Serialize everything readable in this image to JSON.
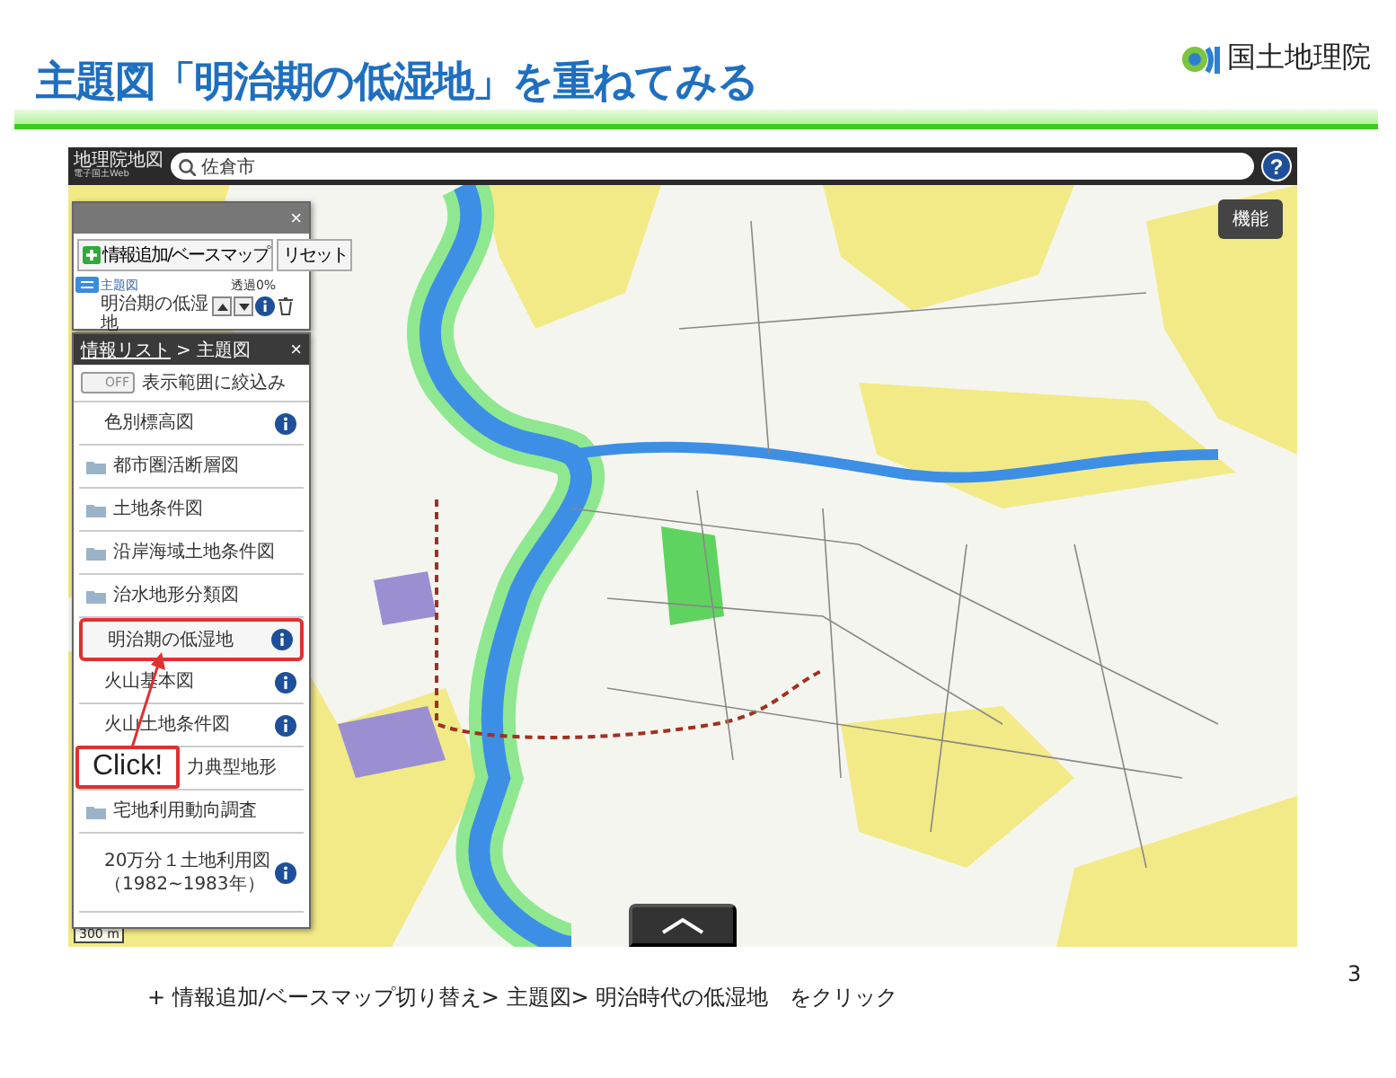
{
  "slide": {
    "title": "主題図「明治期の低湿地」を重ねてみる",
    "logo": "国土地理院",
    "page_number": "3",
    "caption": "+ 情報追加/ベースマップ切り替え> 主題図> 明治時代の低湿地　をクリック"
  },
  "app": {
    "brand": "地理院地図",
    "brand_sub": "電子国土Web",
    "search": {
      "value": "佐倉市"
    },
    "help": "?",
    "function_button": "機能",
    "scale": "300 m",
    "layer_panel": {
      "close": "×",
      "add_button": "情報追加/ベースマップ",
      "reset_button": "リセット",
      "layer": {
        "category": "主題図",
        "name": "明治期の低湿地",
        "opacity": "透過0%"
      }
    },
    "info_list": {
      "breadcrumb_link": "情報リスト",
      "breadcrumb_rest": "> 主題図",
      "close": "×",
      "filter": {
        "on": false,
        "state_label": "OFF",
        "label": "表示範囲に絞込み"
      },
      "items": [
        {
          "label": "色別標高図",
          "kind": "layer",
          "info": true,
          "highlighted": false
        },
        {
          "label": "都市圏活断層図",
          "kind": "folder",
          "info": false,
          "highlighted": false
        },
        {
          "label": "土地条件図",
          "kind": "folder",
          "info": false,
          "highlighted": false
        },
        {
          "label": "沿岸海域土地条件図",
          "kind": "folder",
          "info": false,
          "highlighted": false
        },
        {
          "label": "治水地形分類図",
          "kind": "folder",
          "info": false,
          "highlighted": false
        },
        {
          "label": "明治期の低湿地",
          "kind": "layer",
          "info": true,
          "highlighted": true
        },
        {
          "label": "火山基本図",
          "kind": "layer",
          "info": true,
          "highlighted": false
        },
        {
          "label": "火山土地条件図",
          "kind": "layer",
          "info": true,
          "highlighted": false
        },
        {
          "label": "力典型地形",
          "kind": "covered",
          "info": false,
          "highlighted": false
        },
        {
          "label": "宅地利用動向調査",
          "kind": "folder",
          "info": false,
          "highlighted": false
        },
        {
          "label": "20万分１土地利用図",
          "note": "（1982~1983年）",
          "kind": "layer",
          "info": true,
          "highlighted": false
        }
      ]
    }
  },
  "callout": {
    "text": "Click!"
  }
}
